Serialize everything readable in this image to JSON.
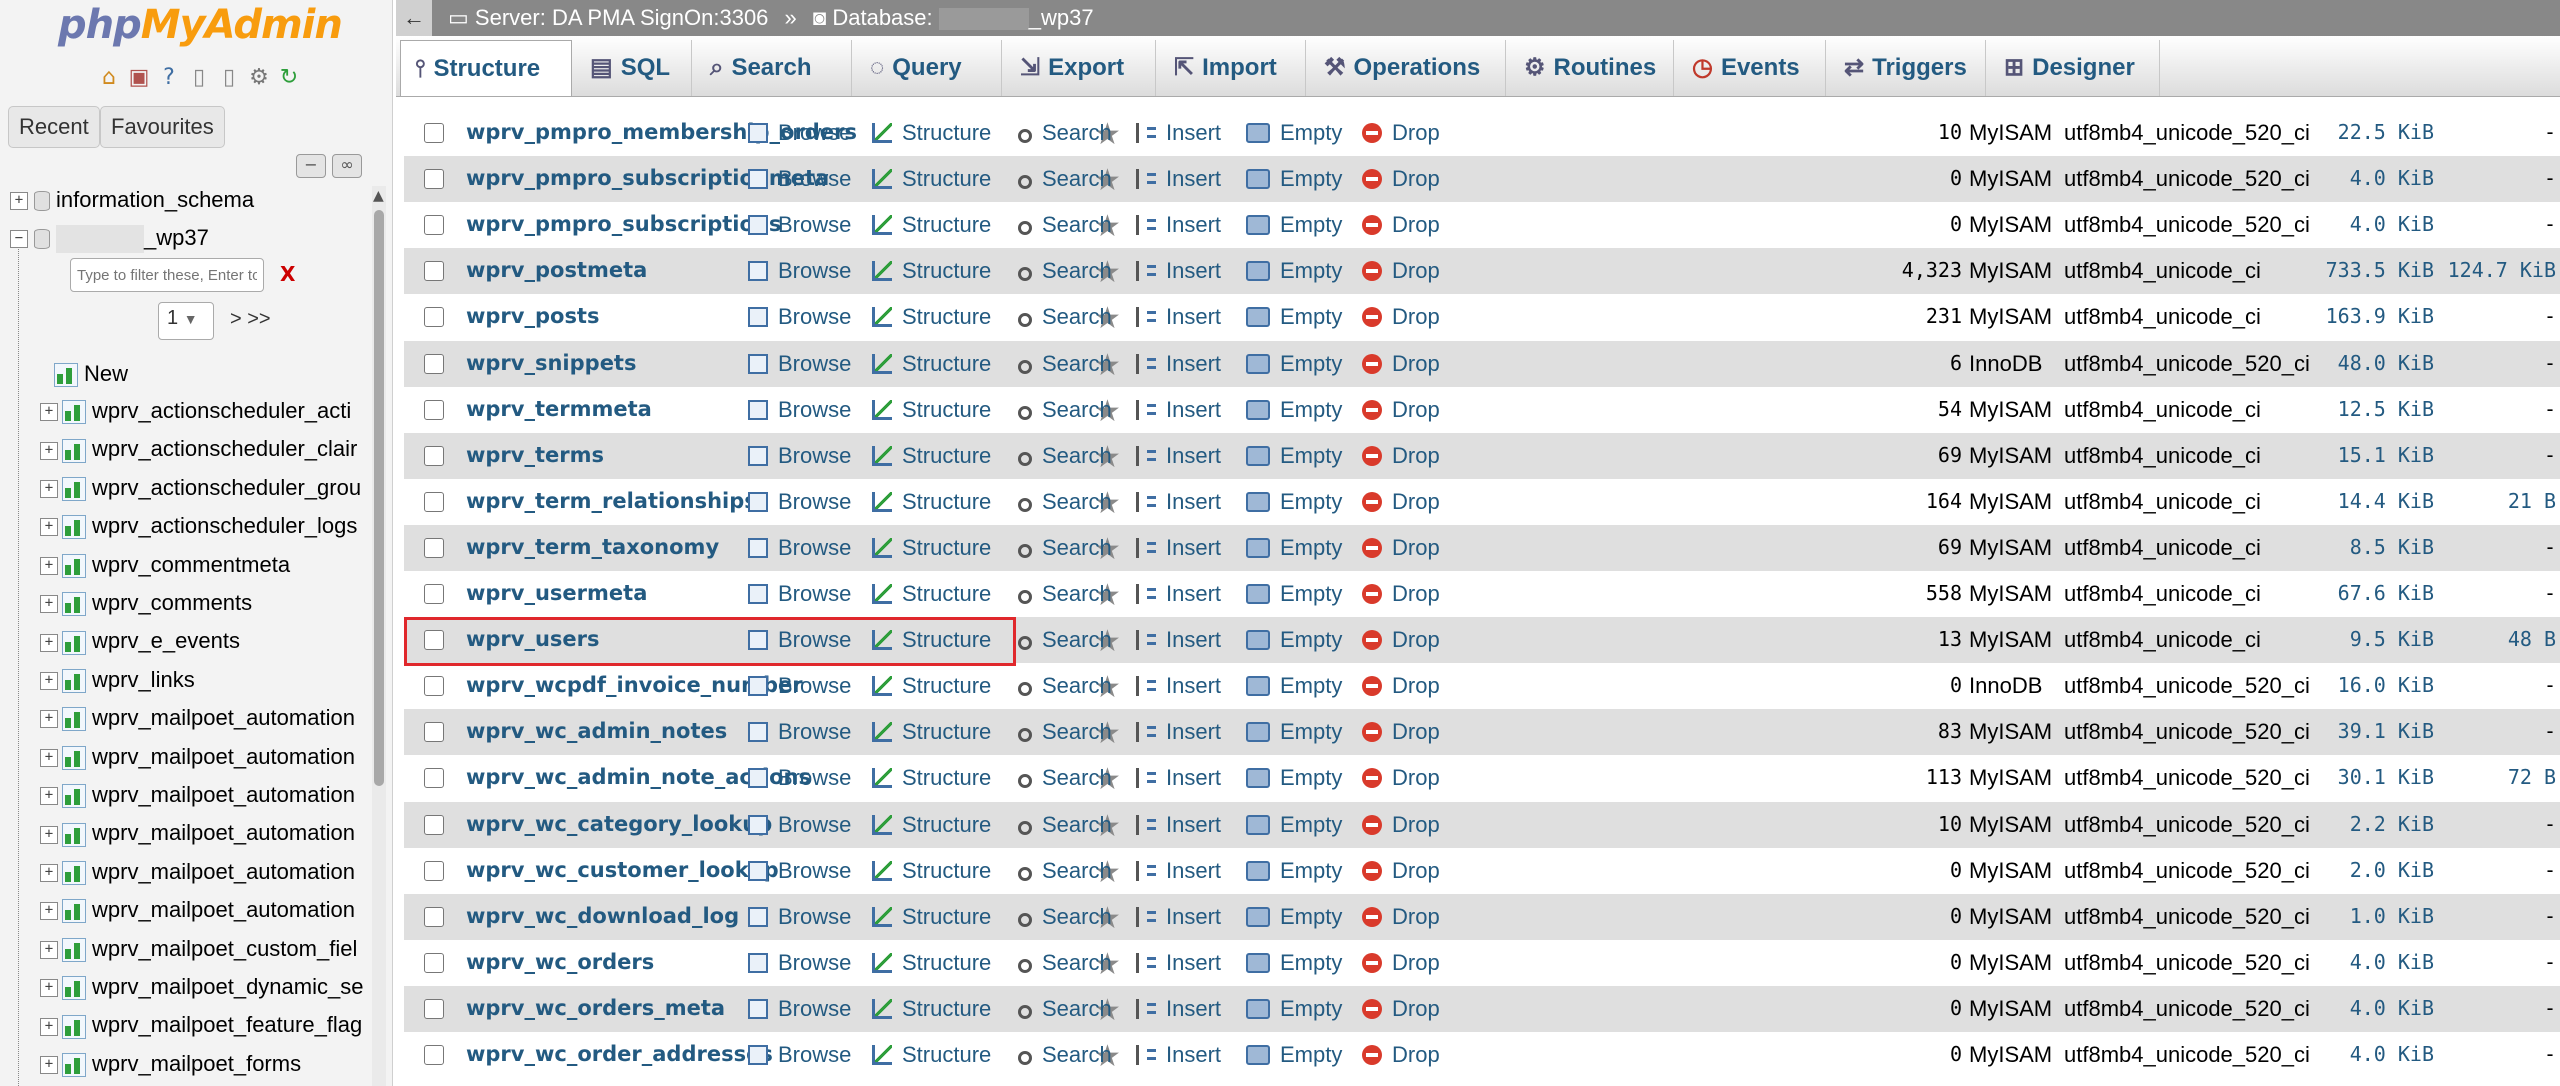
{
  "app": {
    "logo_part1": "php",
    "logo_part2": "MyAdmin"
  },
  "nav": {
    "tabs": [
      "Recent",
      "Favourites"
    ],
    "filter_placeholder": "Type to filter these, Enter to search all",
    "filter_clear": "X",
    "page_select": "1",
    "page_next": "> >>",
    "databases": [
      {
        "name": "information_schema"
      },
      {
        "name": "_wp37"
      }
    ],
    "new_label": "New",
    "tables": [
      "wprv_actionscheduler_acti",
      "wprv_actionscheduler_clair",
      "wprv_actionscheduler_grou",
      "wprv_actionscheduler_logs",
      "wprv_commentmeta",
      "wprv_comments",
      "wprv_e_events",
      "wprv_links",
      "wprv_mailpoet_automation",
      "wprv_mailpoet_automation",
      "wprv_mailpoet_automation",
      "wprv_mailpoet_automation",
      "wprv_mailpoet_automation",
      "wprv_mailpoet_automation",
      "wprv_mailpoet_custom_fiel",
      "wprv_mailpoet_dynamic_se",
      "wprv_mailpoet_feature_flag",
      "wprv_mailpoet_forms"
    ]
  },
  "breadcrumb": {
    "server_label": "Server: DA PMA SignOn:3306",
    "separator": "»",
    "database_label": "Database:",
    "database_name": "_wp37"
  },
  "tabs": [
    "Structure",
    "SQL",
    "Search",
    "Query",
    "Export",
    "Import",
    "Operations",
    "Routines",
    "Events",
    "Triggers",
    "Designer"
  ],
  "actions": {
    "browse": "Browse",
    "structure": "Structure",
    "search": "Search",
    "insert": "Insert",
    "empty": "Empty",
    "drop": "Drop"
  },
  "tables": [
    {
      "name": "wprv_pmpro_membership_orders",
      "rows": "10",
      "engine": "MyISAM",
      "collation": "utf8mb4_unicode_520_ci",
      "size": "22.5 KiB",
      "overhead": "-"
    },
    {
      "name": "wprv_pmpro_subscriptionmeta",
      "rows": "0",
      "engine": "MyISAM",
      "collation": "utf8mb4_unicode_520_ci",
      "size": "4.0 KiB",
      "overhead": "-"
    },
    {
      "name": "wprv_pmpro_subscriptions",
      "rows": "0",
      "engine": "MyISAM",
      "collation": "utf8mb4_unicode_520_ci",
      "size": "4.0 KiB",
      "overhead": "-"
    },
    {
      "name": "wprv_postmeta",
      "rows": "4,323",
      "engine": "MyISAM",
      "collation": "utf8mb4_unicode_ci",
      "size": "733.5 KiB",
      "overhead": "124.7 KiB"
    },
    {
      "name": "wprv_posts",
      "rows": "231",
      "engine": "MyISAM",
      "collation": "utf8mb4_unicode_ci",
      "size": "163.9 KiB",
      "overhead": "-"
    },
    {
      "name": "wprv_snippets",
      "rows": "6",
      "engine": "InnoDB",
      "collation": "utf8mb4_unicode_520_ci",
      "size": "48.0 KiB",
      "overhead": "-"
    },
    {
      "name": "wprv_termmeta",
      "rows": "54",
      "engine": "MyISAM",
      "collation": "utf8mb4_unicode_ci",
      "size": "12.5 KiB",
      "overhead": "-"
    },
    {
      "name": "wprv_terms",
      "rows": "69",
      "engine": "MyISAM",
      "collation": "utf8mb4_unicode_ci",
      "size": "15.1 KiB",
      "overhead": "-"
    },
    {
      "name": "wprv_term_relationships",
      "rows": "164",
      "engine": "MyISAM",
      "collation": "utf8mb4_unicode_ci",
      "size": "14.4 KiB",
      "overhead": "21 B"
    },
    {
      "name": "wprv_term_taxonomy",
      "rows": "69",
      "engine": "MyISAM",
      "collation": "utf8mb4_unicode_ci",
      "size": "8.5 KiB",
      "overhead": "-"
    },
    {
      "name": "wprv_usermeta",
      "rows": "558",
      "engine": "MyISAM",
      "collation": "utf8mb4_unicode_ci",
      "size": "67.6 KiB",
      "overhead": "-"
    },
    {
      "name": "wprv_users",
      "rows": "13",
      "engine": "MyISAM",
      "collation": "utf8mb4_unicode_ci",
      "size": "9.5 KiB",
      "overhead": "48 B"
    },
    {
      "name": "wprv_wcpdf_invoice_number",
      "rows": "0",
      "engine": "InnoDB",
      "collation": "utf8mb4_unicode_520_ci",
      "size": "16.0 KiB",
      "overhead": "-"
    },
    {
      "name": "wprv_wc_admin_notes",
      "rows": "83",
      "engine": "MyISAM",
      "collation": "utf8mb4_unicode_520_ci",
      "size": "39.1 KiB",
      "overhead": "-"
    },
    {
      "name": "wprv_wc_admin_note_actions",
      "rows": "113",
      "engine": "MyISAM",
      "collation": "utf8mb4_unicode_520_ci",
      "size": "30.1 KiB",
      "overhead": "72 B"
    },
    {
      "name": "wprv_wc_category_lookup",
      "rows": "10",
      "engine": "MyISAM",
      "collation": "utf8mb4_unicode_520_ci",
      "size": "2.2 KiB",
      "overhead": "-"
    },
    {
      "name": "wprv_wc_customer_lookup",
      "rows": "0",
      "engine": "MyISAM",
      "collation": "utf8mb4_unicode_520_ci",
      "size": "2.0 KiB",
      "overhead": "-"
    },
    {
      "name": "wprv_wc_download_log",
      "rows": "0",
      "engine": "MyISAM",
      "collation": "utf8mb4_unicode_520_ci",
      "size": "1.0 KiB",
      "overhead": "-"
    },
    {
      "name": "wprv_wc_orders",
      "rows": "0",
      "engine": "MyISAM",
      "collation": "utf8mb4_unicode_520_ci",
      "size": "4.0 KiB",
      "overhead": "-"
    },
    {
      "name": "wprv_wc_orders_meta",
      "rows": "0",
      "engine": "MyISAM",
      "collation": "utf8mb4_unicode_520_ci",
      "size": "4.0 KiB",
      "overhead": "-"
    },
    {
      "name": "wprv_wc_order_addresses",
      "rows": "0",
      "engine": "MyISAM",
      "collation": "utf8mb4_unicode_520_ci",
      "size": "4.0 KiB",
      "overhead": "-"
    }
  ],
  "highlight_color": "#e0282c",
  "link_color": "#235a81"
}
